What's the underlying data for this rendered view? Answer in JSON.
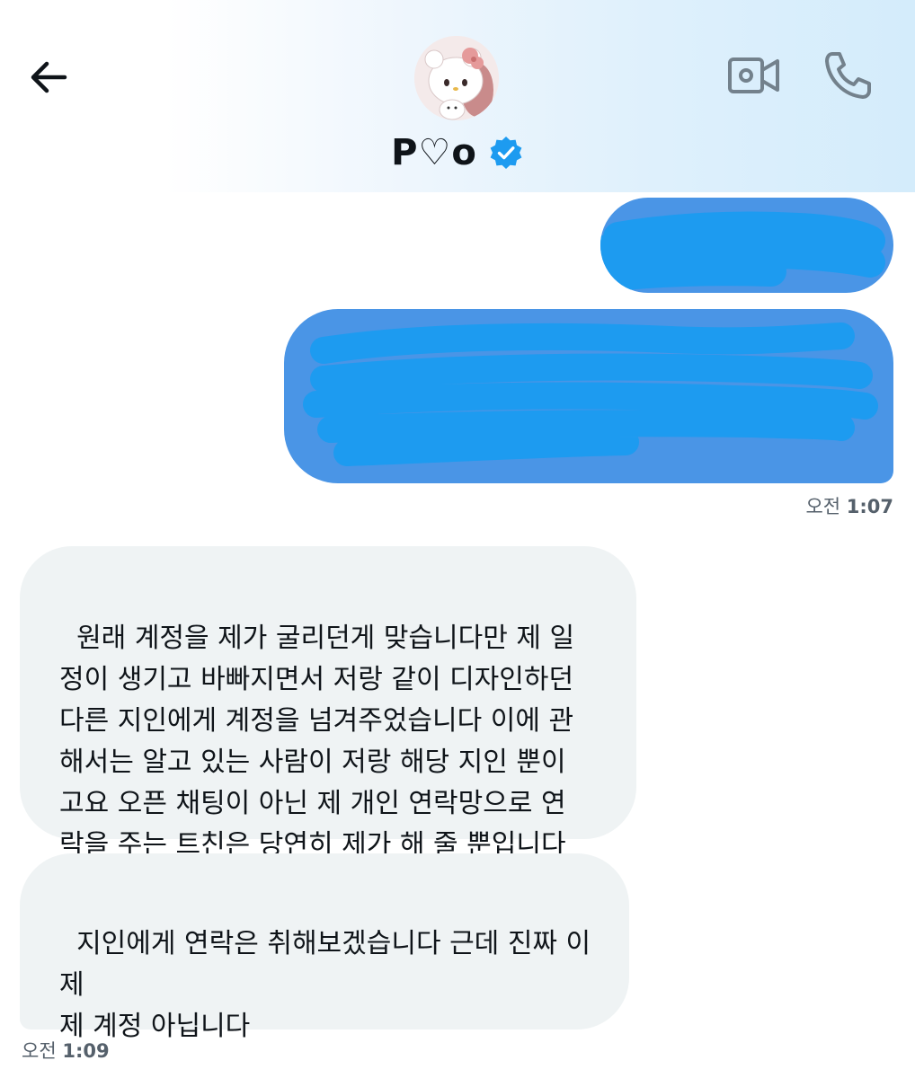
{
  "header": {
    "contact_name": "P♡o",
    "verified": true,
    "icons": {
      "back": "arrow-left-icon",
      "video": "video-camera-icon",
      "call": "phone-icon",
      "verified": "verified-badge-icon",
      "avatar": "avatar"
    }
  },
  "colors": {
    "outgoing_bubble": "#4a95e6",
    "redaction_scribble": "#1d9bf0",
    "incoming_bubble": "#eff3f4",
    "verified_badge": "#1d9bf0"
  },
  "messages": {
    "outgoing_time": {
      "label": "오전",
      "value": "1:07"
    },
    "incoming": [
      {
        "text": "원래 계정을 제가 굴리던게 맞습니다만 제 일\n정이 생기고 바빠지면서 저랑 같이 디자인하던\n다른 지인에게 계정을 넘겨주었습니다 이에 관\n해서는 알고 있는 사람이 저랑 해당 지인 뿐이\n고요 오픈 채팅이 아닌 제 개인 연락망으로 연\n락을 주는 트친은 당연히 제가 해 줄 뿐입니다"
      },
      {
        "text": "지인에게 연락은 취해보겠습니다 근데 진짜 이\n제\n제 계정 아닙니다"
      }
    ],
    "incoming_time": {
      "label": "오전",
      "value": "1:09"
    }
  }
}
